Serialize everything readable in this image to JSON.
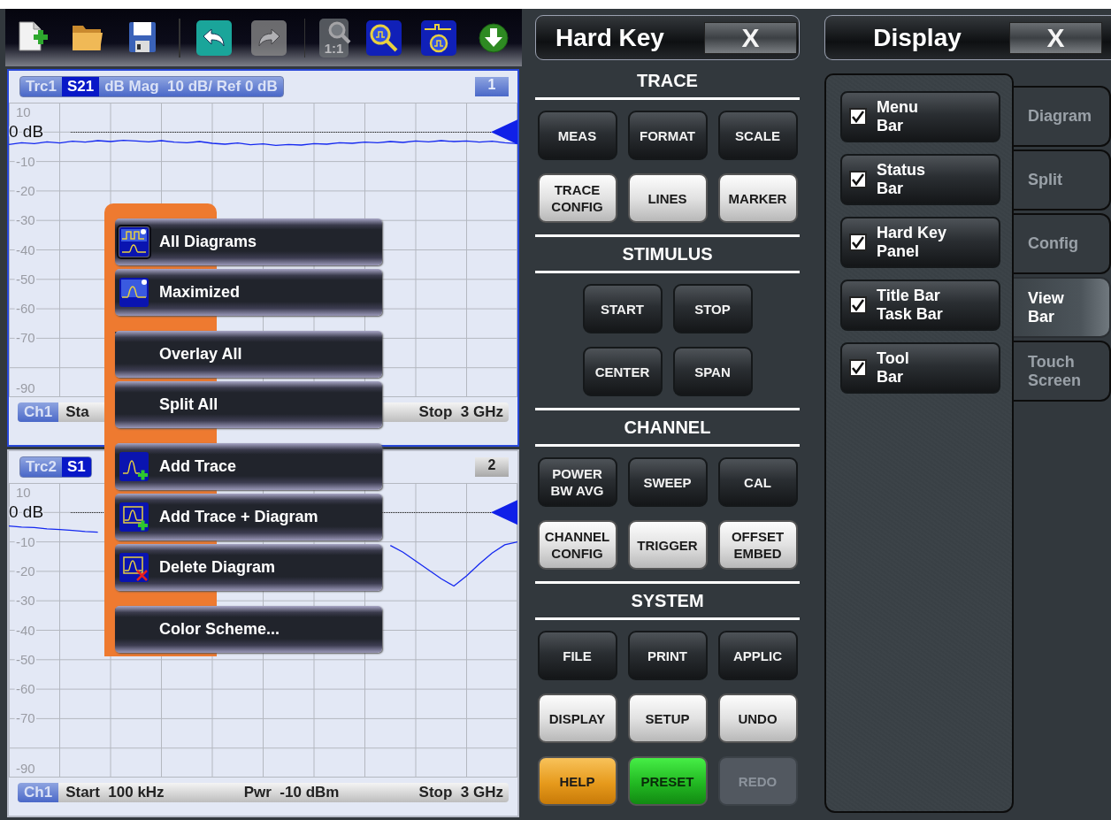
{
  "toolbar": [
    {
      "kind": "new",
      "disabled": false
    },
    {
      "kind": "open",
      "disabled": false
    },
    {
      "kind": "save",
      "disabled": false
    },
    {
      "kind": "undo",
      "disabled": false
    },
    {
      "kind": "redo",
      "disabled": true
    },
    {
      "kind": "zoom-reset",
      "label": "1:1",
      "disabled": true
    },
    {
      "kind": "zoom",
      "disabled": false
    },
    {
      "kind": "zoom-marker",
      "disabled": false
    },
    {
      "kind": "download",
      "disabled": false
    }
  ],
  "diagrams": [
    {
      "selected": true,
      "parameter": "S21",
      "format": "dB Mag  10 dB/ Ref 0 dB",
      "number": "1",
      "ref_label": "0 dB",
      "channel": "Ch1",
      "footer": [
        "Sta",
        "Stop  3 GHz"
      ],
      "chart_data": {
        "type": "line",
        "grid": true,
        "ylim": [
          -90,
          10
        ],
        "yticks": [
          {
            "value": 10,
            "label": "10"
          },
          {
            "value": -10,
            "label": "-10"
          },
          {
            "value": -20,
            "label": "-20"
          },
          {
            "value": -30,
            "label": "-30"
          },
          {
            "value": -40,
            "label": "-40"
          },
          {
            "value": -50,
            "label": "-50"
          },
          {
            "value": -60,
            "label": "-60"
          },
          {
            "value": -70,
            "label": "-70"
          },
          {
            "value": -90,
            "label": "-90"
          }
        ],
        "series": [
          {
            "name": "Trc1",
            "color": "#1428f0",
            "values": [
              -4.2,
              -3.6,
              -3.9,
              -3.3,
              -3.7,
              -3.1,
              -3.4,
              -2.9,
              -3.2,
              -2.8,
              -3.0,
              -3.3,
              -2.9,
              -3.4,
              -3.6,
              -3.2,
              -3.8,
              -4.1,
              -3.7,
              -4.3,
              -4.0,
              -4.5,
              -4.2,
              -4.4,
              -3.9,
              -4.1,
              -3.6,
              -3.8,
              -3.4,
              -3.6,
              -3.2,
              -3.5,
              -3.0,
              -3.3,
              -2.9,
              -3.2,
              -3.0,
              -3.4,
              -3.1,
              -3.6,
              -3.9
            ]
          }
        ]
      }
    },
    {
      "selected": false,
      "parameter": "S1",
      "number": "2",
      "ref_label": "0 dB",
      "channel": "Ch1",
      "footer": [
        "Start  100 kHz",
        "Pwr  -10 dBm",
        "Stop  3 GHz"
      ],
      "chart_data": {
        "type": "line",
        "grid": true,
        "ylim": [
          -90,
          10
        ],
        "yticks": [
          {
            "value": 10,
            "label": "10"
          },
          {
            "value": -10,
            "label": "-10"
          },
          {
            "value": -20,
            "label": "-20"
          },
          {
            "value": -30,
            "label": "-30"
          },
          {
            "value": -40,
            "label": "-40"
          },
          {
            "value": -50,
            "label": "-50"
          },
          {
            "value": -60,
            "label": "-60"
          },
          {
            "value": -70,
            "label": "-70"
          },
          {
            "value": -90,
            "label": "-90"
          }
        ],
        "series": [
          {
            "name": "Trc2",
            "color": "#1428f0",
            "values": [
              -4.6,
              -5.0,
              -5.1,
              -5.6,
              -5.8,
              -6.1,
              -6.5,
              -6.7,
              null,
              null,
              null,
              null,
              null,
              null,
              null,
              null,
              null,
              null,
              null,
              null,
              null,
              null,
              null,
              null,
              null,
              null,
              null,
              null,
              null,
              null,
              -11.2,
              -13.5,
              -16.5,
              -19.5,
              -22.5,
              -25.0,
              -21.5,
              -17.5,
              -13.8,
              -11.0,
              -10.0
            ]
          }
        ]
      }
    }
  ],
  "context_menu": {
    "groups": [
      {
        "items": [
          {
            "label": "All Diagrams",
            "kind": "icon",
            "selected": true
          },
          {
            "label": "Maximized",
            "kind": "icon",
            "selected": false
          }
        ]
      },
      {
        "items": [
          {
            "label": "Overlay All",
            "kind": "text",
            "selected": false
          },
          {
            "label": "Split All",
            "kind": "text",
            "selected": false
          }
        ]
      },
      {
        "items": [
          {
            "label": "Add Trace",
            "kind": "icon",
            "selected": false
          },
          {
            "label": "Add Trace + Diagram",
            "kind": "icon",
            "selected": false
          },
          {
            "label": "Delete Diagram",
            "kind": "icon",
            "selected": false
          }
        ]
      },
      {
        "items": [
          {
            "label": "Color Scheme...",
            "kind": "text",
            "selected": false
          }
        ]
      }
    ]
  },
  "hard_key": {
    "title": "Hard Key",
    "close": "X",
    "sections": [
      {
        "title": "TRACE",
        "buttons": [
          {
            "label": "MEAS",
            "kind": "dark"
          },
          {
            "label": "FORMAT",
            "kind": "dark"
          },
          {
            "label": "SCALE",
            "kind": "dark"
          },
          {
            "label": "TRACE\nCONFIG",
            "kind": "light"
          },
          {
            "label": "LINES",
            "kind": "light"
          },
          {
            "label": "MARKER",
            "kind": "light"
          }
        ]
      },
      {
        "title": "STIMULUS",
        "buttons": [
          {
            "label": "START",
            "kind": "dark"
          },
          {
            "label": "STOP",
            "kind": "dark"
          },
          {
            "label": "CENTER",
            "kind": "dark"
          },
          {
            "label": "SPAN",
            "kind": "dark"
          }
        ]
      },
      {
        "title": "CHANNEL",
        "buttons": [
          {
            "label": "POWER\nBW AVG",
            "kind": "dark"
          },
          {
            "label": "SWEEP",
            "kind": "dark"
          },
          {
            "label": "CAL",
            "kind": "dark"
          },
          {
            "label": "CHANNEL\nCONFIG",
            "kind": "light"
          },
          {
            "label": "TRIGGER",
            "kind": "light"
          },
          {
            "label": "OFFSET\nEMBED",
            "kind": "light"
          }
        ]
      },
      {
        "title": "SYSTEM",
        "buttons": [
          {
            "label": "FILE",
            "kind": "dark"
          },
          {
            "label": "PRINT",
            "kind": "dark"
          },
          {
            "label": "APPLIC",
            "kind": "dark"
          },
          {
            "label": "DISPLAY",
            "kind": "light"
          },
          {
            "label": "SETUP",
            "kind": "light"
          },
          {
            "label": "UNDO",
            "kind": "light"
          },
          {
            "label": "HELP",
            "kind": "orange"
          },
          {
            "label": "PRESET",
            "kind": "green"
          },
          {
            "label": "REDO",
            "kind": "disabled"
          }
        ]
      }
    ]
  },
  "display": {
    "title": "Display",
    "close": "X",
    "options": [
      {
        "label": "Menu\nBar",
        "checked": true
      },
      {
        "label": "Status\nBar",
        "checked": true
      },
      {
        "label": "Hard Key\nPanel",
        "checked": true
      },
      {
        "label": "Title Bar\nTask Bar",
        "checked": true
      },
      {
        "label": "Tool\nBar",
        "checked": true
      }
    ],
    "tabs": [
      {
        "label": "Diagram",
        "selected": false
      },
      {
        "label": "Split",
        "selected": false
      },
      {
        "label": "Config",
        "selected": false
      },
      {
        "label": "View\nBar",
        "selected": true
      },
      {
        "label": "Touch\nScreen",
        "selected": false
      }
    ]
  }
}
